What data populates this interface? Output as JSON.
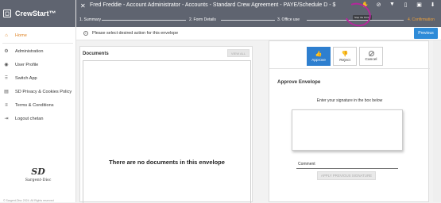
{
  "app": {
    "name": "CrewStart™",
    "logo_glyph": "◻"
  },
  "sidebar": {
    "items": [
      {
        "label": "Home",
        "icon": "home-icon",
        "glyph": "⌂",
        "active": true
      },
      {
        "label": "Administration",
        "icon": "gear-icon",
        "glyph": "⚙",
        "active": false
      },
      {
        "label": "User Profile",
        "icon": "user-icon",
        "glyph": "◉",
        "active": false
      },
      {
        "label": "Switch App",
        "icon": "apps-grid-icon",
        "glyph": "⠿",
        "active": false
      },
      {
        "label": "SD Privacy & Cookies Policy",
        "icon": "document-icon",
        "glyph": "▤",
        "active": false
      },
      {
        "label": "Terms & Conditions",
        "icon": "list-icon",
        "glyph": "≡",
        "active": false
      },
      {
        "label": "Logout chetan",
        "icon": "logout-icon",
        "glyph": "⇥",
        "active": false
      }
    ],
    "footer_logo": {
      "mark": "SD",
      "text": "Sargent-Disc"
    },
    "copyright": "© Sargent-Disc 2024. All Rights reserved"
  },
  "header": {
    "close_glyph": "✕",
    "title": "Fred Freddie - Account Administrator - Accounts - Standard Crew Agreement - PAYE/Schedule D - $",
    "tooltip": "Stop the Finish",
    "tools": [
      {
        "name": "hand-icon",
        "glyph": "✋"
      },
      {
        "name": "block-icon",
        "glyph": "⊘"
      },
      {
        "name": "thumbs-down-icon",
        "glyph": "▼"
      },
      {
        "name": "file-icon",
        "glyph": "▯"
      },
      {
        "name": "save-icon",
        "glyph": "▣"
      },
      {
        "name": "download-icon",
        "glyph": "⬇"
      }
    ],
    "steps": [
      {
        "label": "1. Summary",
        "active": false
      },
      {
        "label": "2. Form Details",
        "active": false
      },
      {
        "label": "3. Office use",
        "active": false
      },
      {
        "label": "4. Confirmation",
        "active": true
      }
    ],
    "accent_color": "#f0a23a",
    "annotation_color": "#b4279b"
  },
  "notice": {
    "icon_glyph": "i",
    "message": "Please select desired action for this envelope",
    "previous_label": "Previous"
  },
  "documents": {
    "title": "Documents",
    "view_all_label": "VIEW ALL",
    "empty_message": "There are no documents in this envelope"
  },
  "approval": {
    "actions": [
      {
        "label": "Approve",
        "glyph": "👍",
        "primary": true
      },
      {
        "label": "Reject",
        "glyph": "👎",
        "primary": false
      },
      {
        "label": "Cancel",
        "glyph": "",
        "primary": false
      }
    ],
    "title": "Approve Envelope",
    "signature_prompt": "Enter your signature in the box below",
    "comment_label": "Comment",
    "apply_label": "APPLY PREVIOUS SIGNATURE"
  }
}
